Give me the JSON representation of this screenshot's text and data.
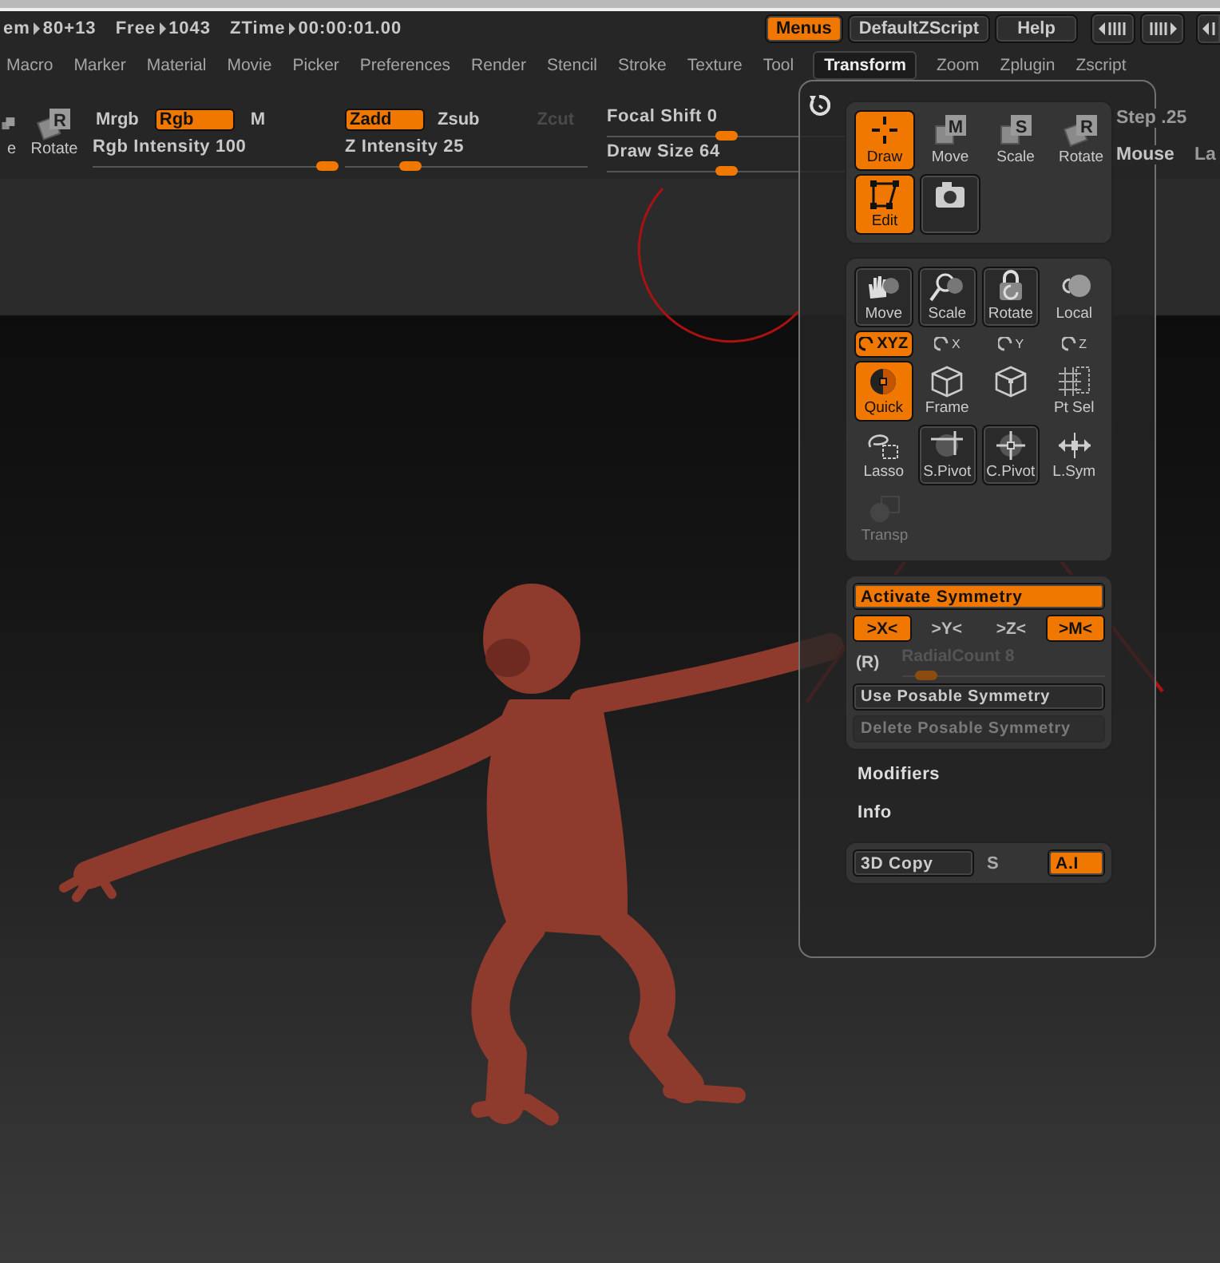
{
  "status": [
    {
      "label": "em",
      "value": "80+13"
    },
    {
      "label": "Free",
      "value": "1043"
    },
    {
      "label": "ZTime",
      "value": "00:00:01.00"
    }
  ],
  "top_buttons": [
    {
      "label": "Menus",
      "selected": true
    },
    {
      "label": "DefaultZScript",
      "selected": false
    },
    {
      "label": "Help",
      "selected": false
    }
  ],
  "menu": [
    {
      "label": "Macro",
      "selected": false
    },
    {
      "label": "Marker",
      "selected": false
    },
    {
      "label": "Material",
      "selected": false
    },
    {
      "label": "Movie",
      "selected": false
    },
    {
      "label": "Picker",
      "selected": false
    },
    {
      "label": "Preferences",
      "selected": false
    },
    {
      "label": "Render",
      "selected": false
    },
    {
      "label": "Stencil",
      "selected": false
    },
    {
      "label": "Stroke",
      "selected": false
    },
    {
      "label": "Texture",
      "selected": false
    },
    {
      "label": "Tool",
      "selected": false
    },
    {
      "label": "Transform",
      "selected": true
    },
    {
      "label": "Zoom",
      "selected": false
    },
    {
      "label": "Zplugin",
      "selected": false
    },
    {
      "label": "Zscript",
      "selected": false
    }
  ],
  "toolbar": {
    "tools": [
      {
        "label": "e"
      },
      {
        "label": "Rotate",
        "badge": "R"
      }
    ],
    "rgb_modes": [
      {
        "label": "Mrgb",
        "selected": false
      },
      {
        "label": "Rgb",
        "selected": true
      },
      {
        "label": "M",
        "selected": false
      }
    ],
    "z_modes": [
      {
        "label": "Zadd",
        "selected": true,
        "disabled": false
      },
      {
        "label": "Zsub",
        "selected": false,
        "disabled": false
      },
      {
        "label": "Zcut",
        "selected": false,
        "disabled": true
      }
    ],
    "sliders": [
      {
        "label": "Rgb Intensity",
        "value": "100",
        "level": 0.97
      },
      {
        "label": "Z Intensity",
        "value": "25",
        "level": 0.27
      },
      {
        "label": "Focal Shift",
        "value": "0",
        "level": 0.5
      },
      {
        "label": "Draw Size",
        "value": "64",
        "level": 0.5
      }
    ],
    "right": [
      {
        "label": "Step",
        "value": ".25"
      },
      {
        "label": "Mouse"
      },
      {
        "label": "La"
      }
    ]
  },
  "transform": {
    "view_tools": [
      {
        "label": "Draw",
        "selected": true
      },
      {
        "label": "Move",
        "badge": "M",
        "selected": false
      },
      {
        "label": "Scale",
        "badge": "S",
        "selected": false
      },
      {
        "label": "Rotate",
        "badge": "R",
        "selected": false
      },
      {
        "label": "Edit",
        "selected": true
      },
      {
        "selected": false
      }
    ],
    "tool_rows": [
      [
        {
          "label": "Move",
          "kind": "button",
          "selected": false
        },
        {
          "label": "Scale",
          "kind": "button",
          "selected": false
        },
        {
          "label": "Rotate",
          "kind": "button",
          "selected": false
        },
        {
          "label": "Local",
          "kind": "icon",
          "selected": false
        }
      ],
      [
        {
          "label": "XYZ",
          "kind": "axis",
          "selected": true
        },
        {
          "label": "X",
          "kind": "axis",
          "selected": false
        },
        {
          "label": "Y",
          "kind": "axis",
          "selected": false
        },
        {
          "label": "Z",
          "kind": "axis",
          "selected": false
        }
      ],
      [
        {
          "label": "Quick",
          "kind": "icon",
          "selected": true
        },
        {
          "label": "Frame",
          "kind": "icon",
          "selected": false
        },
        {
          "kind": "icon",
          "selected": false
        },
        {
          "label": "Pt Sel",
          "kind": "icon",
          "selected": false
        }
      ],
      [
        {
          "label": "Lasso",
          "kind": "icon",
          "selected": false
        },
        {
          "label": "S.Pivot",
          "kind": "button",
          "selected": false
        },
        {
          "label": "C.Pivot",
          "kind": "button",
          "selected": false
        },
        {
          "label": "L.Sym",
          "kind": "icon",
          "selected": false
        }
      ],
      [
        {
          "label": "Transp",
          "kind": "icon",
          "selected": false,
          "disabled": true
        }
      ]
    ],
    "symmetry": {
      "activate": {
        "label": "Activate Symmetry",
        "on": true
      },
      "axes": [
        {
          "label": ">X<",
          "on": true
        },
        {
          "label": ">Y<",
          "on": false
        },
        {
          "label": ">Z<",
          "on": false
        },
        {
          "label": ">M<",
          "on": true
        }
      ],
      "radial": {
        "toggle": "(R)",
        "label": "RadialCount",
        "value": "8",
        "level": 0.12,
        "disabled": true
      },
      "posable": [
        {
          "label": "Use Posable Symmetry",
          "disabled": false
        },
        {
          "label": "Delete Posable Symmetry",
          "disabled": true
        }
      ]
    },
    "sections": [
      "Modifiers",
      "Info"
    ],
    "copy_row": [
      {
        "label": "3D Copy",
        "kind": "button",
        "on": false
      },
      {
        "label": "S",
        "kind": "text"
      },
      {
        "label": "A.I",
        "kind": "button",
        "on": true
      }
    ]
  }
}
